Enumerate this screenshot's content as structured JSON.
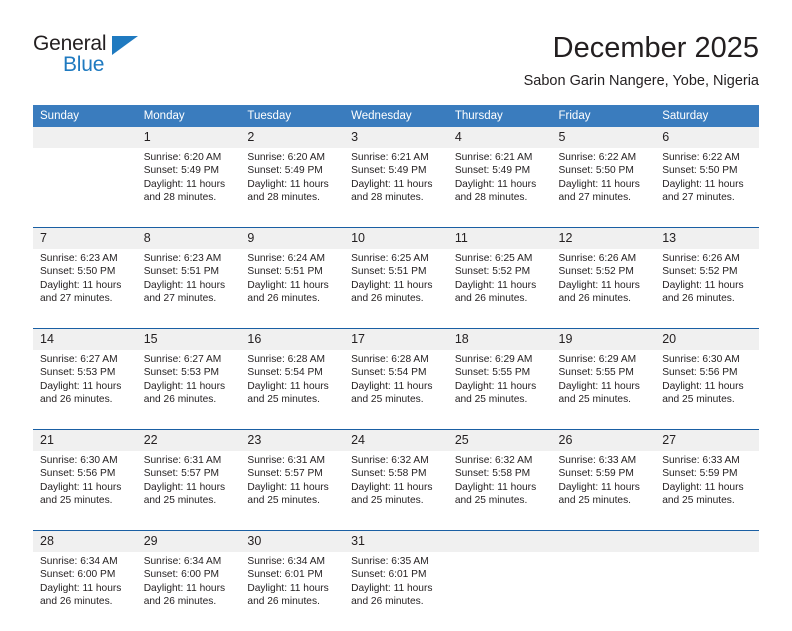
{
  "brand": {
    "name_top": "General",
    "name_bottom": "Blue",
    "triangle_icon": "blue-triangle-logo-mark",
    "colors": {
      "text": "#231f20",
      "accent": "#1f7ac0"
    }
  },
  "header": {
    "title": "December 2025",
    "subtitle": "Sabon Garin Nangere, Yobe, Nigeria"
  },
  "calendar": {
    "colors": {
      "header_bg": "#3a7cbe",
      "header_text": "#ffffff",
      "daynum_bg": "#f0f0f0",
      "row_divider": "#1a5fa3",
      "body_text": "#231f20"
    },
    "weekday_headers": [
      "Sunday",
      "Monday",
      "Tuesday",
      "Wednesday",
      "Thursday",
      "Friday",
      "Saturday"
    ],
    "weeks": [
      {
        "days": [
          {
            "number": "",
            "sunrise": "",
            "sunset": "",
            "daylight_1": "",
            "daylight_2": ""
          },
          {
            "number": "1",
            "sunrise": "Sunrise: 6:20 AM",
            "sunset": "Sunset: 5:49 PM",
            "daylight_1": "Daylight: 11 hours",
            "daylight_2": "and 28 minutes."
          },
          {
            "number": "2",
            "sunrise": "Sunrise: 6:20 AM",
            "sunset": "Sunset: 5:49 PM",
            "daylight_1": "Daylight: 11 hours",
            "daylight_2": "and 28 minutes."
          },
          {
            "number": "3",
            "sunrise": "Sunrise: 6:21 AM",
            "sunset": "Sunset: 5:49 PM",
            "daylight_1": "Daylight: 11 hours",
            "daylight_2": "and 28 minutes."
          },
          {
            "number": "4",
            "sunrise": "Sunrise: 6:21 AM",
            "sunset": "Sunset: 5:49 PM",
            "daylight_1": "Daylight: 11 hours",
            "daylight_2": "and 28 minutes."
          },
          {
            "number": "5",
            "sunrise": "Sunrise: 6:22 AM",
            "sunset": "Sunset: 5:50 PM",
            "daylight_1": "Daylight: 11 hours",
            "daylight_2": "and 27 minutes."
          },
          {
            "number": "6",
            "sunrise": "Sunrise: 6:22 AM",
            "sunset": "Sunset: 5:50 PM",
            "daylight_1": "Daylight: 11 hours",
            "daylight_2": "and 27 minutes."
          }
        ]
      },
      {
        "days": [
          {
            "number": "7",
            "sunrise": "Sunrise: 6:23 AM",
            "sunset": "Sunset: 5:50 PM",
            "daylight_1": "Daylight: 11 hours",
            "daylight_2": "and 27 minutes."
          },
          {
            "number": "8",
            "sunrise": "Sunrise: 6:23 AM",
            "sunset": "Sunset: 5:51 PM",
            "daylight_1": "Daylight: 11 hours",
            "daylight_2": "and 27 minutes."
          },
          {
            "number": "9",
            "sunrise": "Sunrise: 6:24 AM",
            "sunset": "Sunset: 5:51 PM",
            "daylight_1": "Daylight: 11 hours",
            "daylight_2": "and 26 minutes."
          },
          {
            "number": "10",
            "sunrise": "Sunrise: 6:25 AM",
            "sunset": "Sunset: 5:51 PM",
            "daylight_1": "Daylight: 11 hours",
            "daylight_2": "and 26 minutes."
          },
          {
            "number": "11",
            "sunrise": "Sunrise: 6:25 AM",
            "sunset": "Sunset: 5:52 PM",
            "daylight_1": "Daylight: 11 hours",
            "daylight_2": "and 26 minutes."
          },
          {
            "number": "12",
            "sunrise": "Sunrise: 6:26 AM",
            "sunset": "Sunset: 5:52 PM",
            "daylight_1": "Daylight: 11 hours",
            "daylight_2": "and 26 minutes."
          },
          {
            "number": "13",
            "sunrise": "Sunrise: 6:26 AM",
            "sunset": "Sunset: 5:52 PM",
            "daylight_1": "Daylight: 11 hours",
            "daylight_2": "and 26 minutes."
          }
        ]
      },
      {
        "days": [
          {
            "number": "14",
            "sunrise": "Sunrise: 6:27 AM",
            "sunset": "Sunset: 5:53 PM",
            "daylight_1": "Daylight: 11 hours",
            "daylight_2": "and 26 minutes."
          },
          {
            "number": "15",
            "sunrise": "Sunrise: 6:27 AM",
            "sunset": "Sunset: 5:53 PM",
            "daylight_1": "Daylight: 11 hours",
            "daylight_2": "and 26 minutes."
          },
          {
            "number": "16",
            "sunrise": "Sunrise: 6:28 AM",
            "sunset": "Sunset: 5:54 PM",
            "daylight_1": "Daylight: 11 hours",
            "daylight_2": "and 25 minutes."
          },
          {
            "number": "17",
            "sunrise": "Sunrise: 6:28 AM",
            "sunset": "Sunset: 5:54 PM",
            "daylight_1": "Daylight: 11 hours",
            "daylight_2": "and 25 minutes."
          },
          {
            "number": "18",
            "sunrise": "Sunrise: 6:29 AM",
            "sunset": "Sunset: 5:55 PM",
            "daylight_1": "Daylight: 11 hours",
            "daylight_2": "and 25 minutes."
          },
          {
            "number": "19",
            "sunrise": "Sunrise: 6:29 AM",
            "sunset": "Sunset: 5:55 PM",
            "daylight_1": "Daylight: 11 hours",
            "daylight_2": "and 25 minutes."
          },
          {
            "number": "20",
            "sunrise": "Sunrise: 6:30 AM",
            "sunset": "Sunset: 5:56 PM",
            "daylight_1": "Daylight: 11 hours",
            "daylight_2": "and 25 minutes."
          }
        ]
      },
      {
        "days": [
          {
            "number": "21",
            "sunrise": "Sunrise: 6:30 AM",
            "sunset": "Sunset: 5:56 PM",
            "daylight_1": "Daylight: 11 hours",
            "daylight_2": "and 25 minutes."
          },
          {
            "number": "22",
            "sunrise": "Sunrise: 6:31 AM",
            "sunset": "Sunset: 5:57 PM",
            "daylight_1": "Daylight: 11 hours",
            "daylight_2": "and 25 minutes."
          },
          {
            "number": "23",
            "sunrise": "Sunrise: 6:31 AM",
            "sunset": "Sunset: 5:57 PM",
            "daylight_1": "Daylight: 11 hours",
            "daylight_2": "and 25 minutes."
          },
          {
            "number": "24",
            "sunrise": "Sunrise: 6:32 AM",
            "sunset": "Sunset: 5:58 PM",
            "daylight_1": "Daylight: 11 hours",
            "daylight_2": "and 25 minutes."
          },
          {
            "number": "25",
            "sunrise": "Sunrise: 6:32 AM",
            "sunset": "Sunset: 5:58 PM",
            "daylight_1": "Daylight: 11 hours",
            "daylight_2": "and 25 minutes."
          },
          {
            "number": "26",
            "sunrise": "Sunrise: 6:33 AM",
            "sunset": "Sunset: 5:59 PM",
            "daylight_1": "Daylight: 11 hours",
            "daylight_2": "and 25 minutes."
          },
          {
            "number": "27",
            "sunrise": "Sunrise: 6:33 AM",
            "sunset": "Sunset: 5:59 PM",
            "daylight_1": "Daylight: 11 hours",
            "daylight_2": "and 25 minutes."
          }
        ]
      },
      {
        "days": [
          {
            "number": "28",
            "sunrise": "Sunrise: 6:34 AM",
            "sunset": "Sunset: 6:00 PM",
            "daylight_1": "Daylight: 11 hours",
            "daylight_2": "and 26 minutes."
          },
          {
            "number": "29",
            "sunrise": "Sunrise: 6:34 AM",
            "sunset": "Sunset: 6:00 PM",
            "daylight_1": "Daylight: 11 hours",
            "daylight_2": "and 26 minutes."
          },
          {
            "number": "30",
            "sunrise": "Sunrise: 6:34 AM",
            "sunset": "Sunset: 6:01 PM",
            "daylight_1": "Daylight: 11 hours",
            "daylight_2": "and 26 minutes."
          },
          {
            "number": "31",
            "sunrise": "Sunrise: 6:35 AM",
            "sunset": "Sunset: 6:01 PM",
            "daylight_1": "Daylight: 11 hours",
            "daylight_2": "and 26 minutes."
          },
          {
            "number": "",
            "sunrise": "",
            "sunset": "",
            "daylight_1": "",
            "daylight_2": ""
          },
          {
            "number": "",
            "sunrise": "",
            "sunset": "",
            "daylight_1": "",
            "daylight_2": ""
          },
          {
            "number": "",
            "sunrise": "",
            "sunset": "",
            "daylight_1": "",
            "daylight_2": ""
          }
        ]
      }
    ]
  }
}
